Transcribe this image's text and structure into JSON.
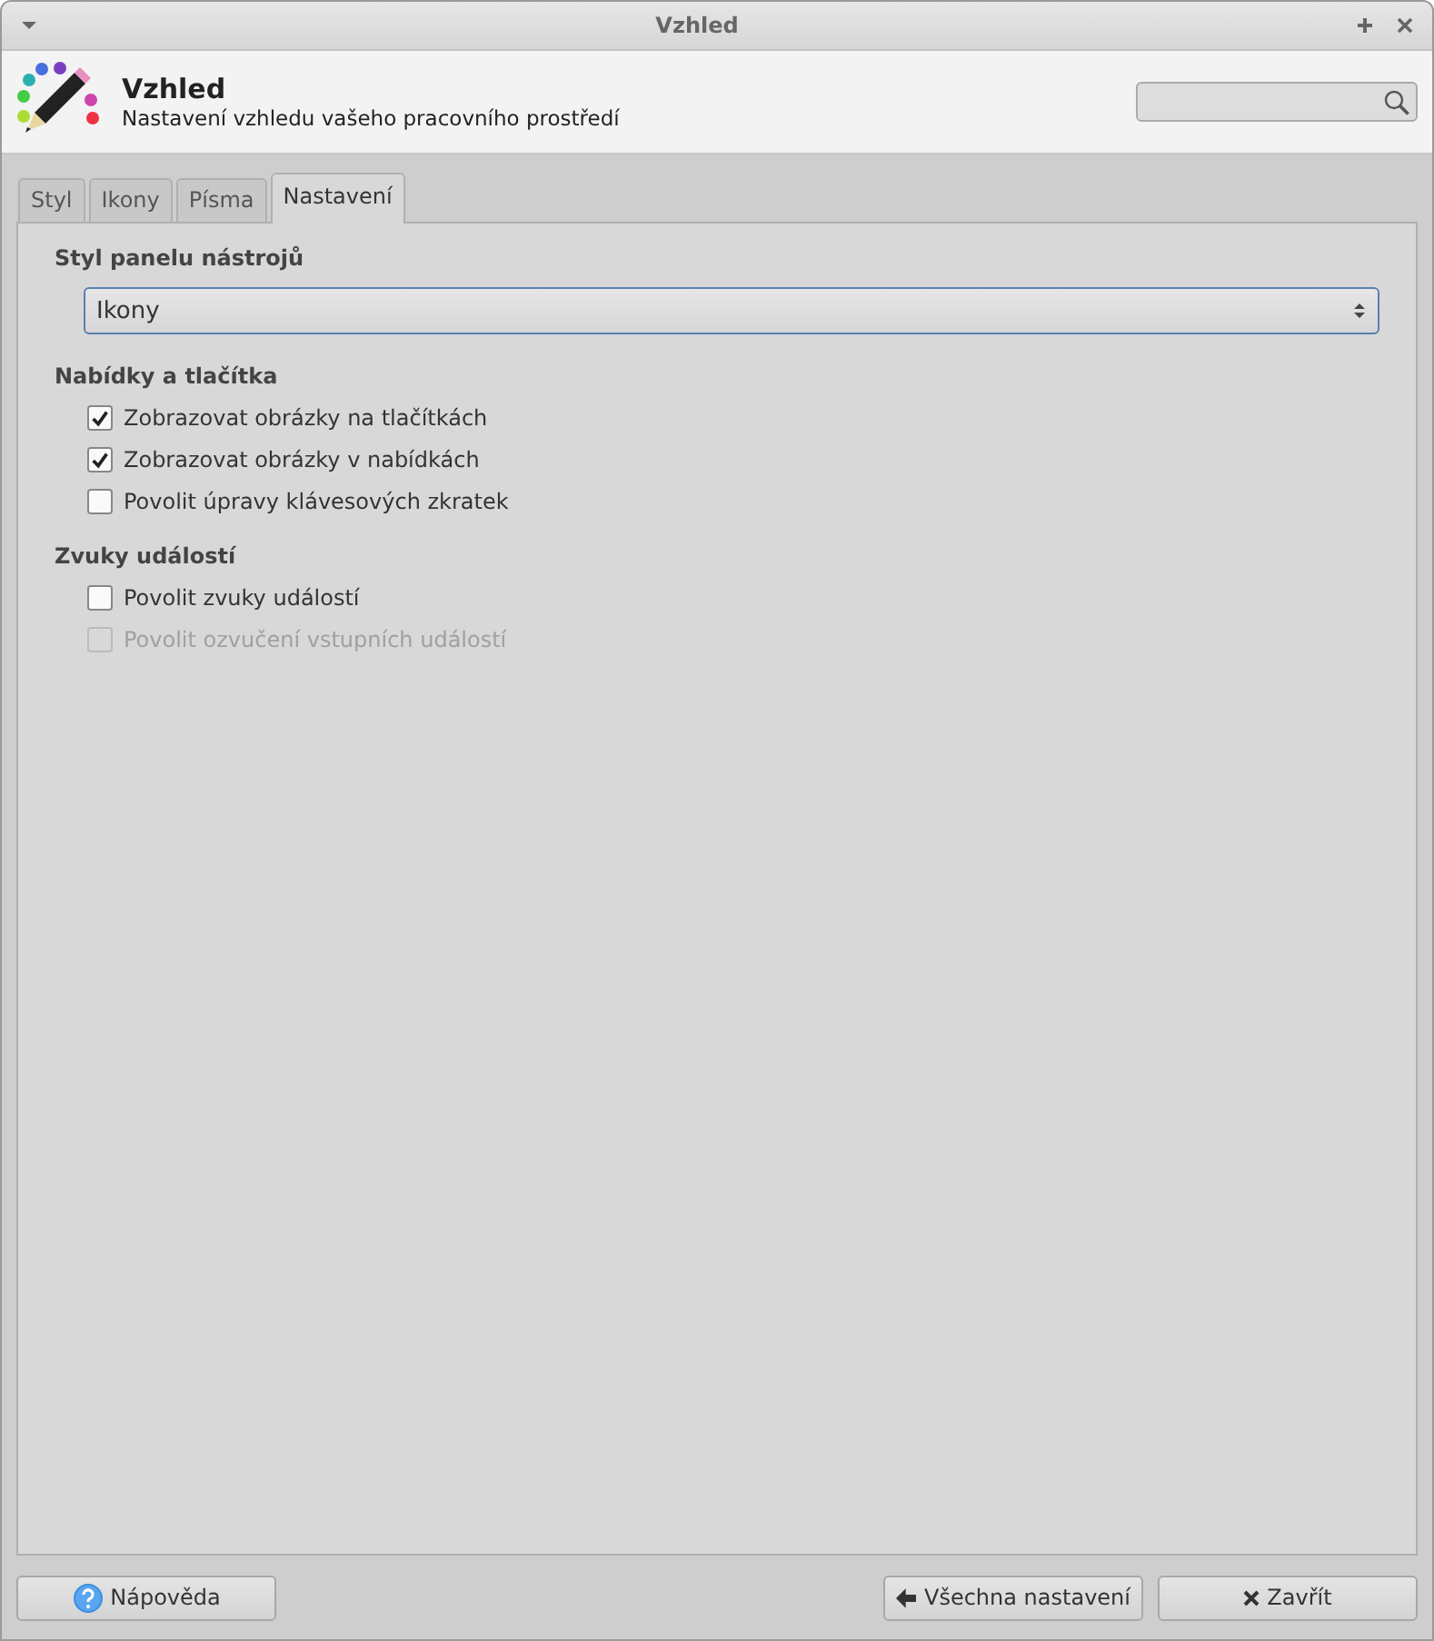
{
  "window": {
    "title": "Vzhled"
  },
  "header": {
    "title": "Vzhled",
    "subtitle": "Nastavení vzhledu vašeho pracovního prostředí"
  },
  "tabs": [
    {
      "label": "Styl",
      "selected": false
    },
    {
      "label": "Ikony",
      "selected": false
    },
    {
      "label": "Písma",
      "selected": false
    },
    {
      "label": "Nastavení",
      "selected": true
    }
  ],
  "sections": [
    {
      "title": "Styl panelu nástrojů",
      "kind": "dropdown",
      "value": "Ikony"
    },
    {
      "title": "Nabídky a tlačítka",
      "kind": "checks",
      "options": [
        {
          "label": "Zobrazovat obrázky na tlačítkách",
          "checked": true,
          "disabled": false
        },
        {
          "label": "Zobrazovat obrázky v nabídkách",
          "checked": true,
          "disabled": false
        },
        {
          "label": "Povolit úpravy klávesových zkratek",
          "checked": false,
          "disabled": false
        }
      ]
    },
    {
      "title": "Zvuky událostí",
      "kind": "checks",
      "options": [
        {
          "label": "Povolit zvuky událostí",
          "checked": false,
          "disabled": false
        },
        {
          "label": "Povolit ozvučení vstupních událostí",
          "checked": false,
          "disabled": true
        }
      ]
    }
  ],
  "buttons": [
    {
      "label": "Nápověda",
      "kind": "help"
    },
    {
      "label": "Všechna nastavení",
      "kind": "back"
    },
    {
      "label": "Zavřít",
      "kind": "close"
    }
  ]
}
